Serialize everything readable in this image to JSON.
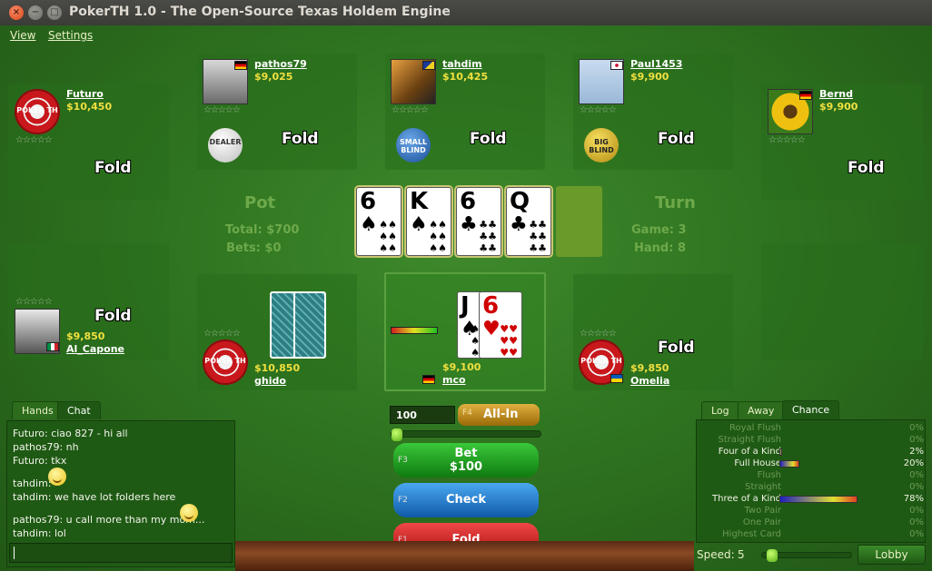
{
  "window": {
    "title": "PokerTH 1.0 - The Open-Source Texas Holdem Engine"
  },
  "menu": {
    "view": "View",
    "settings": "Settings"
  },
  "players": {
    "futuro": {
      "name": "Futuro",
      "cash": "$10,450",
      "status": "Fold",
      "stars": "☆☆☆☆☆"
    },
    "pathos79": {
      "name": "pathos79",
      "cash": "$9,025",
      "status": "Fold",
      "stars": "☆☆☆☆☆"
    },
    "tahdim": {
      "name": "tahdim",
      "cash": "$10,425",
      "status": "Fold",
      "stars": "☆☆☆☆☆"
    },
    "paul1453": {
      "name": "Paul1453",
      "cash": "$9,900",
      "status": "Fold",
      "stars": "☆☆☆☆☆"
    },
    "bernd": {
      "name": "Bernd",
      "cash": "$9,900",
      "status": "Fold",
      "stars": "☆☆☆☆☆"
    },
    "al_capone": {
      "name": "Al_Capone",
      "cash": "$9,850",
      "status": "Fold",
      "stars": "☆☆☆☆☆"
    },
    "ghido": {
      "name": "ghido",
      "cash": "$10,850",
      "stars": "☆☆☆☆☆"
    },
    "mco": {
      "name": "mco",
      "cash": "$9,100"
    },
    "omelia": {
      "name": "Omelia",
      "cash": "$9,850",
      "status": "Fold",
      "stars": "☆☆☆☆☆"
    }
  },
  "chips": {
    "logo": "POKER TH",
    "dealer": "DEALER",
    "small_blind": "SMALL BLIND",
    "big_blind": "BIG BLIND"
  },
  "pot": {
    "title": "Pot",
    "total": "Total: $700",
    "bets": "Bets: $0"
  },
  "round": {
    "title": "Turn",
    "game": "Game: 3",
    "hand": "Hand: 8"
  },
  "board": [
    {
      "rank": "6",
      "suit": "♠",
      "color": "#000000"
    },
    {
      "rank": "K",
      "suit": "♠",
      "color": "#000000"
    },
    {
      "rank": "6",
      "suit": "♣",
      "color": "#000000"
    },
    {
      "rank": "Q",
      "suit": "♣",
      "color": "#000000"
    }
  ],
  "hole": [
    {
      "rank": "J",
      "suit": "♠",
      "color": "#000000"
    },
    {
      "rank": "6",
      "suit": "♥",
      "color": "#d00000"
    }
  ],
  "chat": {
    "tabs": [
      "Hands",
      "Chat"
    ],
    "lines": [
      "Futuro: ciao 827 - hi all",
      "pathos79: nh",
      "Futuro: tkx",
      "tahdim:",
      "tahdim: we have lot folders here",
      "pathos79: u call more than my mom...",
      "tahdim: lol"
    ]
  },
  "controls": {
    "bet_input": "100",
    "allin_key": "F4",
    "allin_label": "All-In",
    "bet_key": "F3",
    "bet_label": "Bet",
    "bet_amount": "$100",
    "check_key": "F2",
    "check_label": "Check",
    "fold_key": "F1",
    "fold_label": "Fold"
  },
  "chance": {
    "tabs": [
      "Log",
      "Away",
      "Chance"
    ],
    "rows": [
      {
        "name": "Royal Flush",
        "pct": "0%",
        "value": 0,
        "active": false
      },
      {
        "name": "Straight Flush",
        "pct": "0%",
        "value": 0,
        "active": false
      },
      {
        "name": "Four of a Kind",
        "pct": "2%",
        "value": 2,
        "active": true
      },
      {
        "name": "Full House",
        "pct": "20%",
        "value": 20,
        "active": true
      },
      {
        "name": "Flush",
        "pct": "0%",
        "value": 0,
        "active": false
      },
      {
        "name": "Straight",
        "pct": "0%",
        "value": 0,
        "active": false
      },
      {
        "name": "Three of a Kind",
        "pct": "78%",
        "value": 78,
        "active": true
      },
      {
        "name": "Two Pair",
        "pct": "0%",
        "value": 0,
        "active": false
      },
      {
        "name": "One Pair",
        "pct": "0%",
        "value": 0,
        "active": false
      },
      {
        "name": "Highest Card",
        "pct": "0%",
        "value": 0,
        "active": false
      }
    ]
  },
  "speed": {
    "label": "Speed:",
    "value": "5",
    "level": 0.05
  },
  "lobby": "Lobby",
  "colors": {
    "felt": "#2f7420",
    "cash": "#f0e040",
    "allin": "#b8860b",
    "bet": "#1a9a1a",
    "check": "#1a78c8",
    "fold": "#c81818"
  }
}
